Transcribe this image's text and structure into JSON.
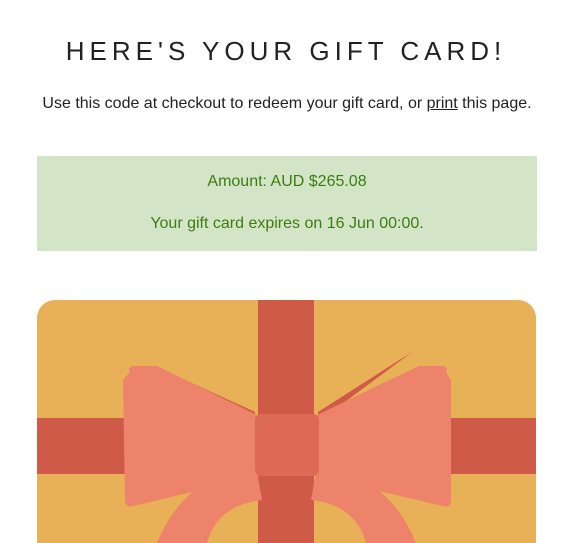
{
  "heading": "HERE'S YOUR GIFT CARD!",
  "intro": {
    "before": "Use this code at checkout to redeem your gift card, or ",
    "link": "print",
    "after": " this page."
  },
  "notice": {
    "amount": "Amount: AUD $265.08",
    "expiry": "Your gift card expires on 16 Jun 00:00."
  },
  "colors": {
    "card_background": "#e8b057",
    "ribbon": "#cf5a47",
    "bow": "#ec836a",
    "notice_background": "#d4e5c7",
    "notice_text": "#3a7d10"
  },
  "icons": {
    "gift_card": "gift-card-illustration"
  }
}
